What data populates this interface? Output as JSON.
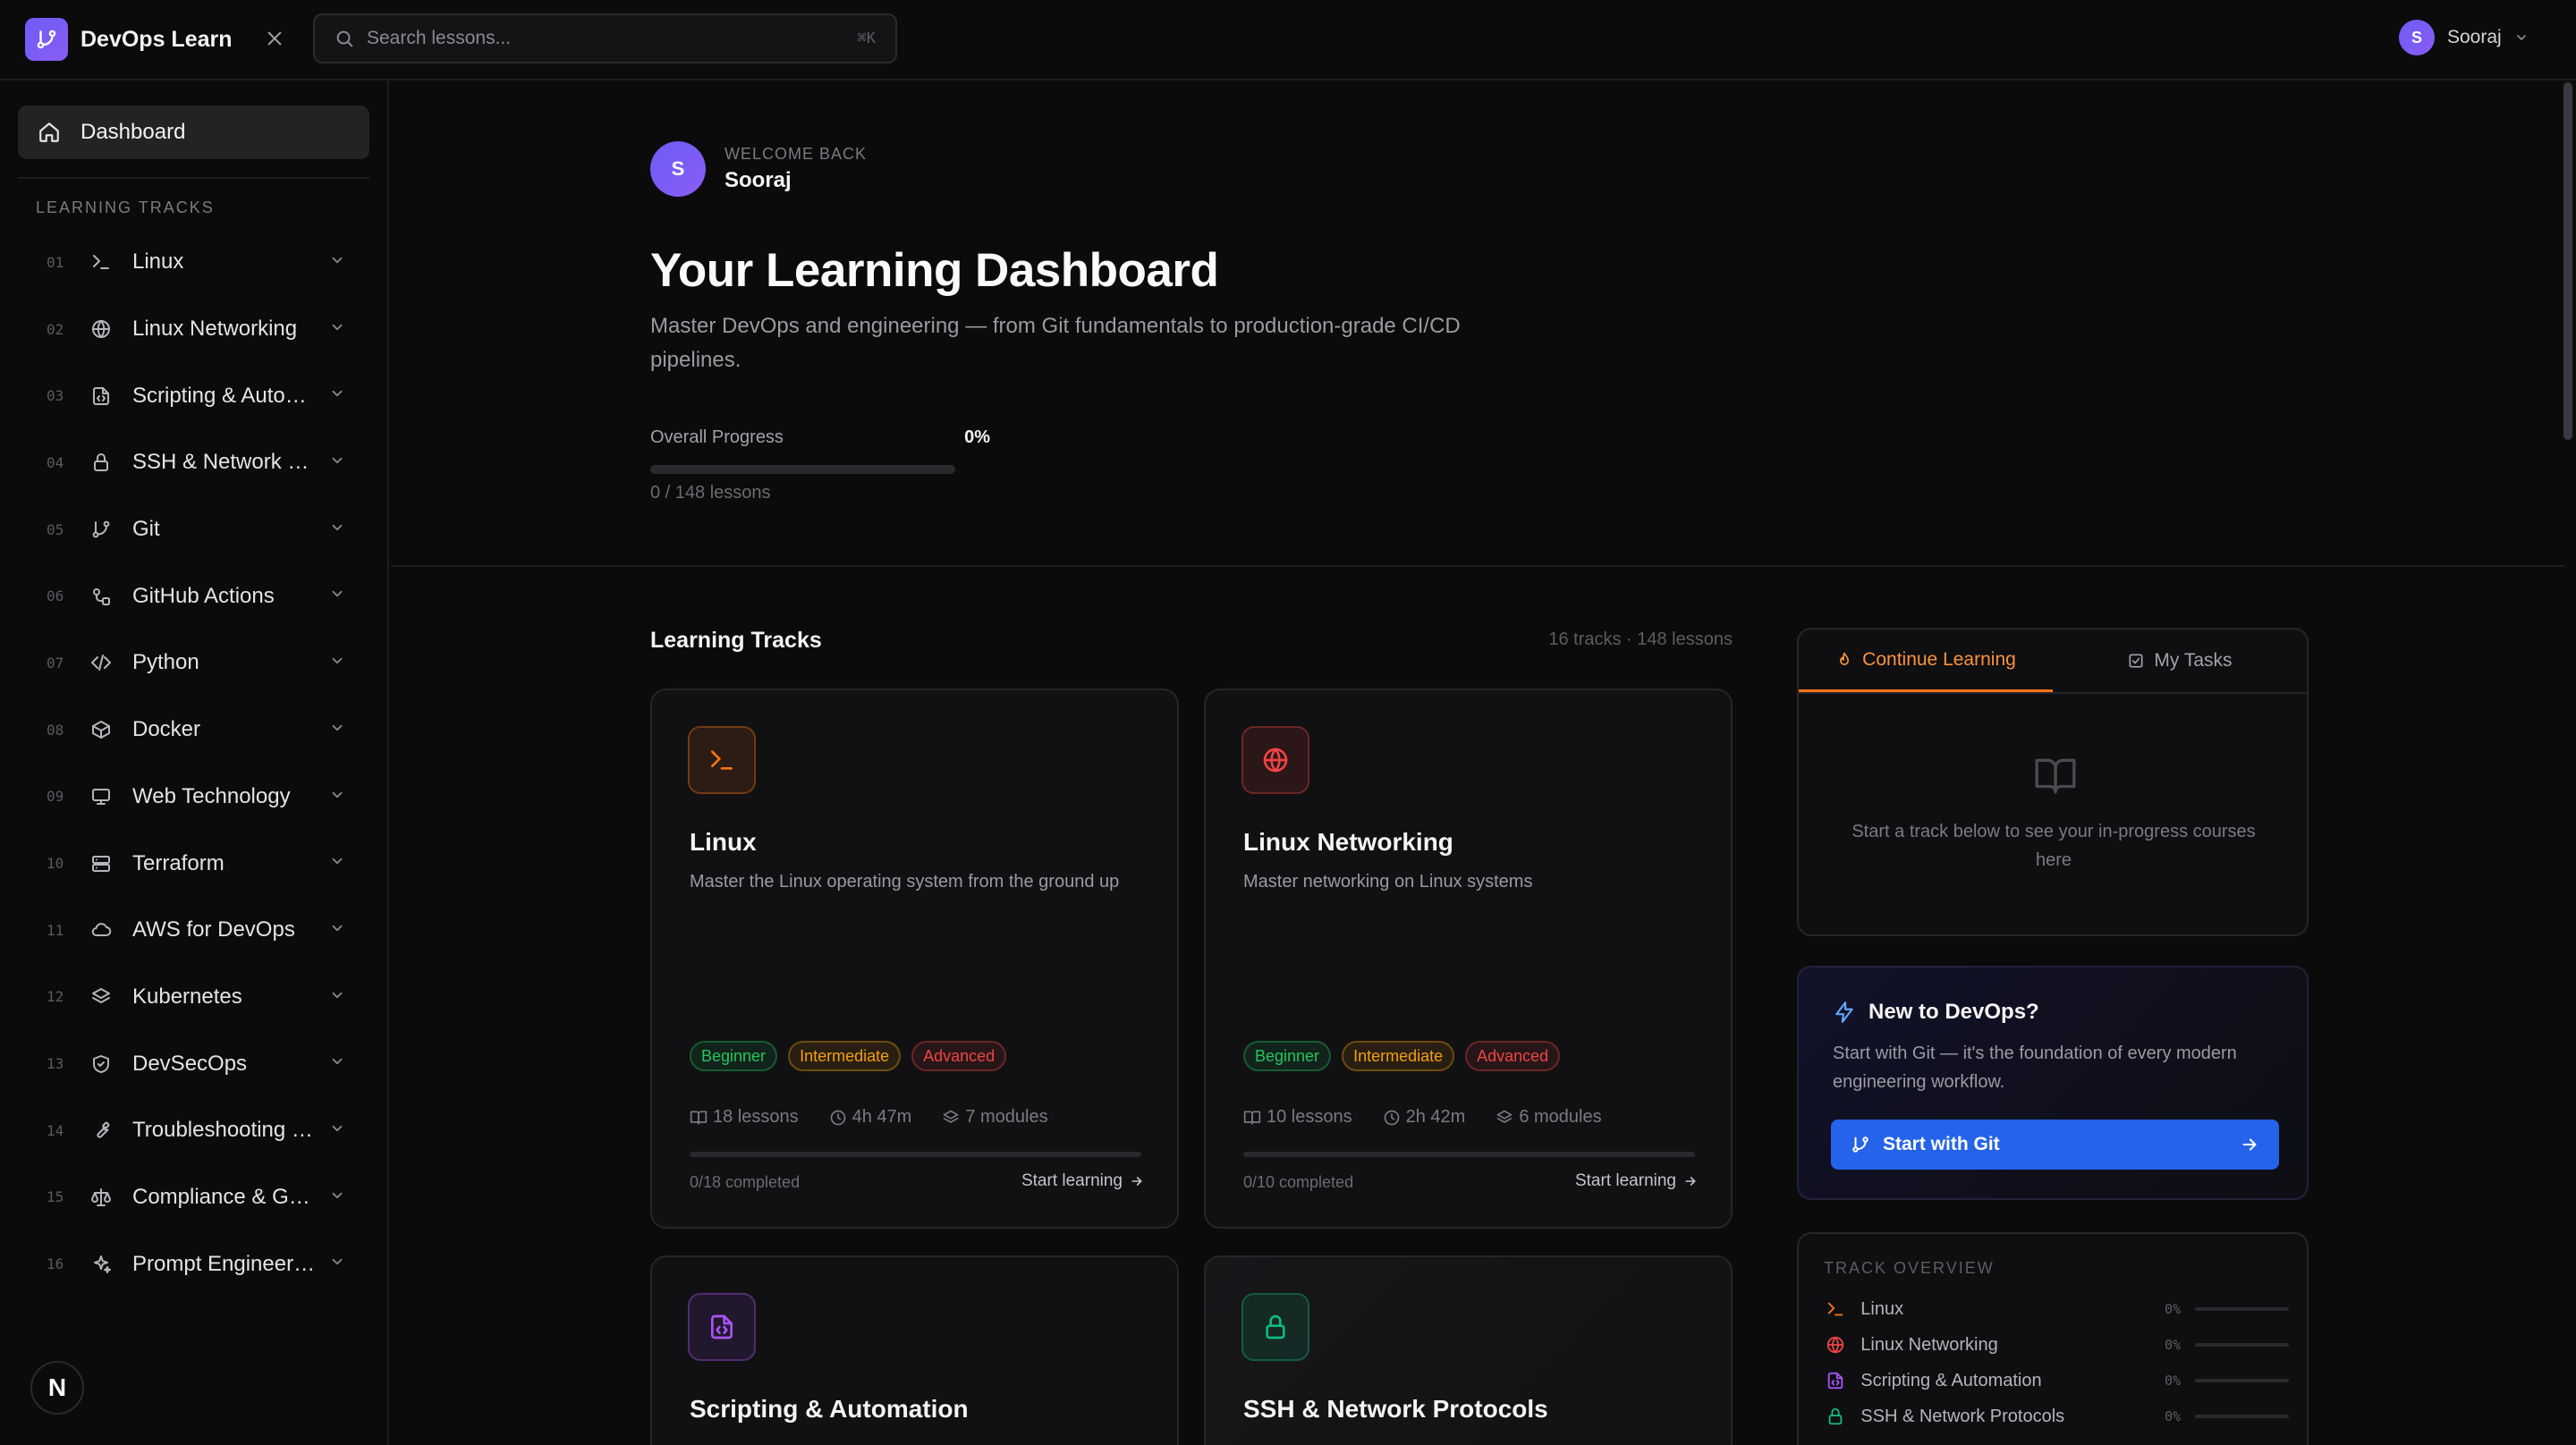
{
  "app": {
    "name": "DevOps Learn"
  },
  "search": {
    "placeholder": "Search lessons...",
    "shortcut": "⌘K"
  },
  "user": {
    "initial": "S",
    "name": "Sooraj"
  },
  "sidebar": {
    "dashboard_label": "Dashboard",
    "section_label": "LEARNING TRACKS",
    "tracks": [
      {
        "num": "01",
        "name": "Linux",
        "icon": "terminal-icon"
      },
      {
        "num": "02",
        "name": "Linux Networking",
        "icon": "globe-icon"
      },
      {
        "num": "03",
        "name": "Scripting & Automation",
        "icon": "file-code-icon"
      },
      {
        "num": "04",
        "name": "SSH & Network Protocols",
        "icon": "lock-icon"
      },
      {
        "num": "05",
        "name": "Git",
        "icon": "git-branch-icon"
      },
      {
        "num": "06",
        "name": "GitHub Actions",
        "icon": "workflow-icon"
      },
      {
        "num": "07",
        "name": "Python",
        "icon": "code-icon"
      },
      {
        "num": "08",
        "name": "Docker",
        "icon": "box-icon"
      },
      {
        "num": "09",
        "name": "Web Technology",
        "icon": "monitor-icon"
      },
      {
        "num": "10",
        "name": "Terraform",
        "icon": "server-icon"
      },
      {
        "num": "11",
        "name": "AWS for DevOps",
        "icon": "cloud-icon"
      },
      {
        "num": "12",
        "name": "Kubernetes",
        "icon": "layers-icon"
      },
      {
        "num": "13",
        "name": "DevSecOps",
        "icon": "shield-icon"
      },
      {
        "num": "14",
        "name": "Troubleshooting & Debugging",
        "icon": "wrench-icon"
      },
      {
        "num": "15",
        "name": "Compliance & Governance",
        "icon": "scale-icon"
      },
      {
        "num": "16",
        "name": "Prompt Engineering",
        "icon": "sparkles-icon"
      }
    ],
    "fab_label": "N"
  },
  "hero": {
    "welcome_label": "WELCOME BACK",
    "name": "Sooraj",
    "title": "Your Learning Dashboard",
    "subtitle": "Master DevOps and engineering — from Git fundamentals to production-grade CI/CD pipelines.",
    "progress_label": "Overall Progress",
    "progress_pct": "0%",
    "progress_value": 0,
    "progress_count": "0 / 148 lessons"
  },
  "tracks_section": {
    "heading": "Learning Tracks",
    "meta": "16 tracks · 148 lessons"
  },
  "cards": [
    {
      "title": "Linux",
      "desc": "Master the Linux operating system from the ground up",
      "icon": "terminal-icon",
      "accent": "#f97316",
      "badges": [
        "Beginner",
        "Intermediate",
        "Advanced"
      ],
      "lessons": "18 lessons",
      "duration": "4h 47m",
      "modules": "7 modules",
      "completed": "0/18 completed",
      "cta": "Start learning"
    },
    {
      "title": "Linux Networking",
      "desc": "Master networking on Linux systems",
      "icon": "globe-icon",
      "accent": "#ef4444",
      "badges": [
        "Beginner",
        "Intermediate",
        "Advanced"
      ],
      "lessons": "10 lessons",
      "duration": "2h 42m",
      "modules": "6 modules",
      "completed": "0/10 completed",
      "cta": "Start learning"
    },
    {
      "title": "Scripting & Automation",
      "icon": "file-code-icon",
      "accent": "#a855f7"
    },
    {
      "title": "SSH & Network Protocols",
      "icon": "lock-icon",
      "accent": "#10b981"
    }
  ],
  "panel": {
    "tab_continue": "Continue Learning",
    "tab_tasks": "My Tasks",
    "empty_text": "Start a track below to see your in-progress courses here"
  },
  "promo": {
    "title": "New to DevOps?",
    "text": "Start with Git — it's the foundation of every modern engineering workflow.",
    "button": "Start with Git"
  },
  "overview": {
    "label": "TRACK OVERVIEW",
    "rows": [
      {
        "name": "Linux",
        "pct": "0%",
        "icon": "terminal-icon"
      },
      {
        "name": "Linux Networking",
        "pct": "0%",
        "icon": "globe-icon"
      },
      {
        "name": "Scripting & Automation",
        "pct": "0%",
        "icon": "file-code-icon"
      },
      {
        "name": "SSH & Network Protocols",
        "pct": "0%",
        "icon": "lock-icon"
      }
    ]
  },
  "colors": {
    "beginner": "#22c55e",
    "intermediate": "#f59e0b",
    "advanced": "#ef4444",
    "primary": "#2563eb",
    "brand": "#7c5cf6"
  }
}
